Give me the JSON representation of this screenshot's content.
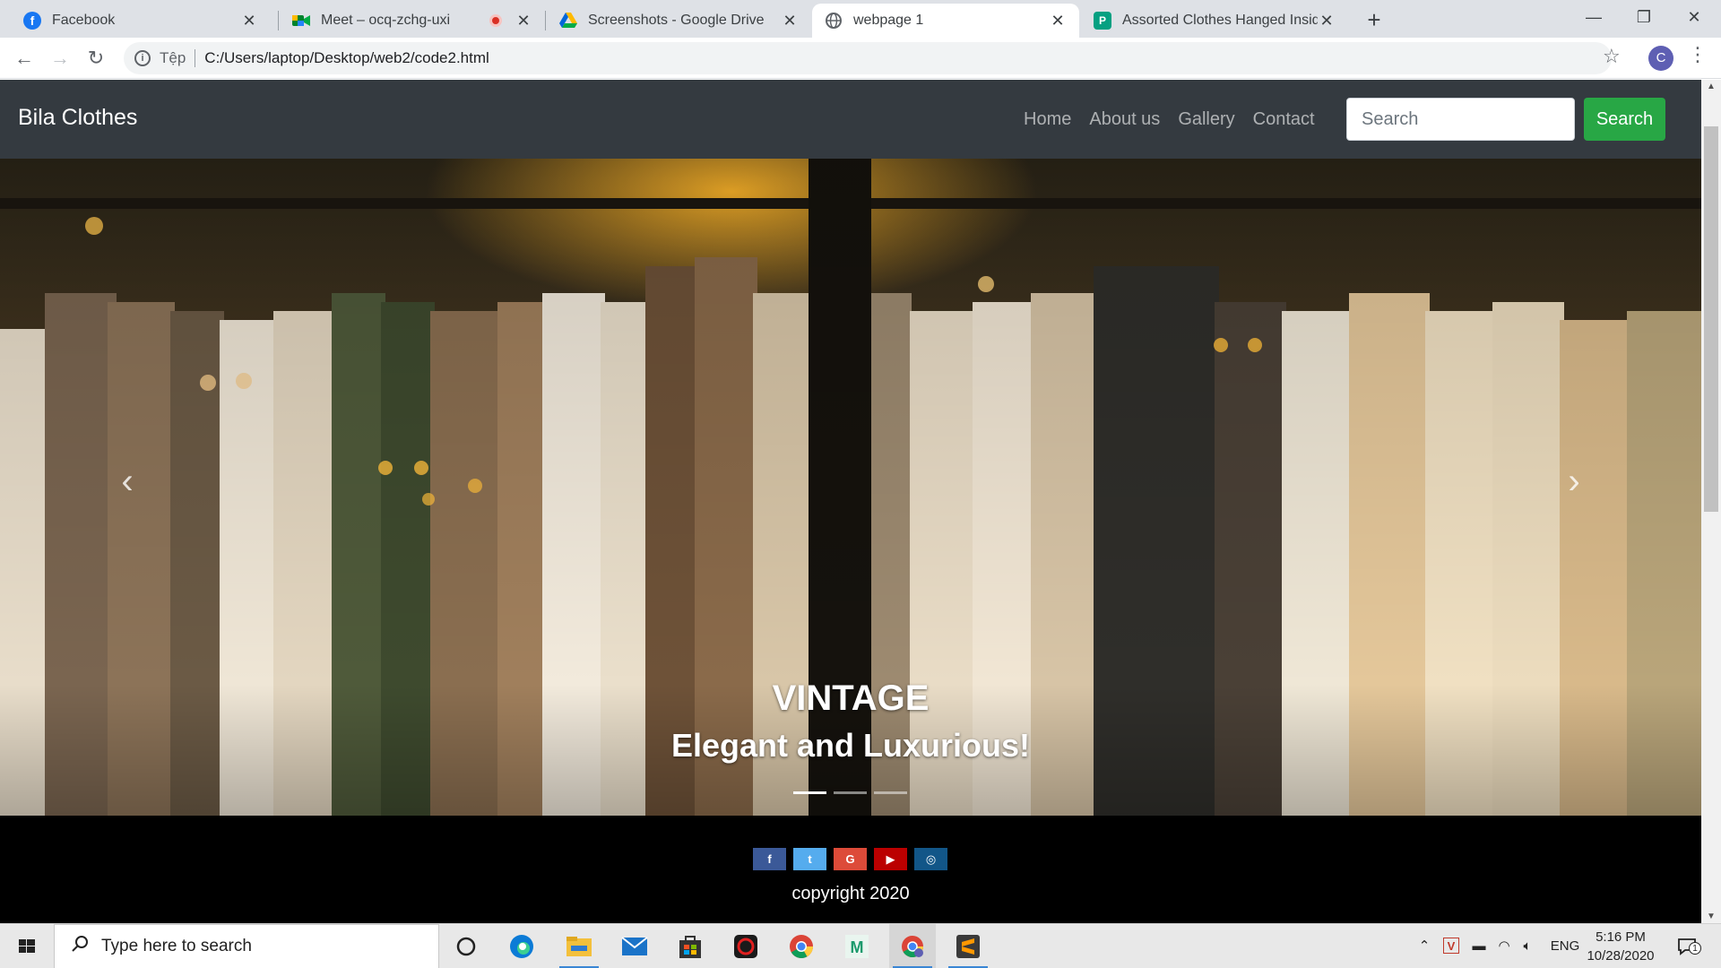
{
  "browser": {
    "tabs": [
      {
        "label": "Facebook",
        "icon": "facebook-icon",
        "color": "#1877f2"
      },
      {
        "label": "Meet – ocq-zchg-uxi",
        "icon": "google-meet-icon",
        "recording": true
      },
      {
        "label": "Screenshots - Google Drive",
        "icon": "google-drive-icon"
      },
      {
        "label": "webpage 1",
        "icon": "globe-icon",
        "active": true
      },
      {
        "label": "Assorted Clothes Hanged Inside",
        "icon": "pexels-icon",
        "color": "#05a081"
      }
    ],
    "address": {
      "scheme_label": "Tệp",
      "url": "C:/Users/laptop/Desktop/web2/code2.html"
    },
    "profile_initial": "C"
  },
  "site": {
    "brand": "Bila Clothes",
    "nav": [
      "Home",
      "About us",
      "Gallery",
      "Contact"
    ],
    "search": {
      "placeholder": "Search",
      "button": "Search"
    },
    "carousel": {
      "title": "VINTAGE",
      "subtitle": "Elegant and Luxurious!",
      "slides": 3,
      "active_slide": 1,
      "prev_glyph": "‹",
      "next_glyph": "›"
    },
    "footer": {
      "socials": [
        {
          "name": "facebook",
          "glyph": "f",
          "color": "#3b5998"
        },
        {
          "name": "twitter",
          "glyph": "t",
          "color": "#55acee"
        },
        {
          "name": "google",
          "glyph": "G",
          "color": "#dd4b39"
        },
        {
          "name": "youtube",
          "glyph": "▶",
          "color": "#bb0000"
        },
        {
          "name": "instagram",
          "glyph": "◎",
          "color": "#125688"
        }
      ],
      "copyright": "copyright 2020"
    },
    "colors": {
      "navbar": "#343a40",
      "success": "#28a745",
      "footer": "#000000"
    }
  },
  "taskbar": {
    "search_placeholder": "Type here to search",
    "apps": [
      "cortana-icon",
      "edge-icon",
      "file-explorer-icon",
      "mail-icon",
      "store-icon",
      "garena-icon",
      "chrome-icon",
      "m-app-icon",
      "chrome-profile-icon",
      "sublime-text-icon"
    ],
    "language": "ENG",
    "time": "5:16 PM",
    "date": "10/28/2020",
    "notifications": "1"
  }
}
